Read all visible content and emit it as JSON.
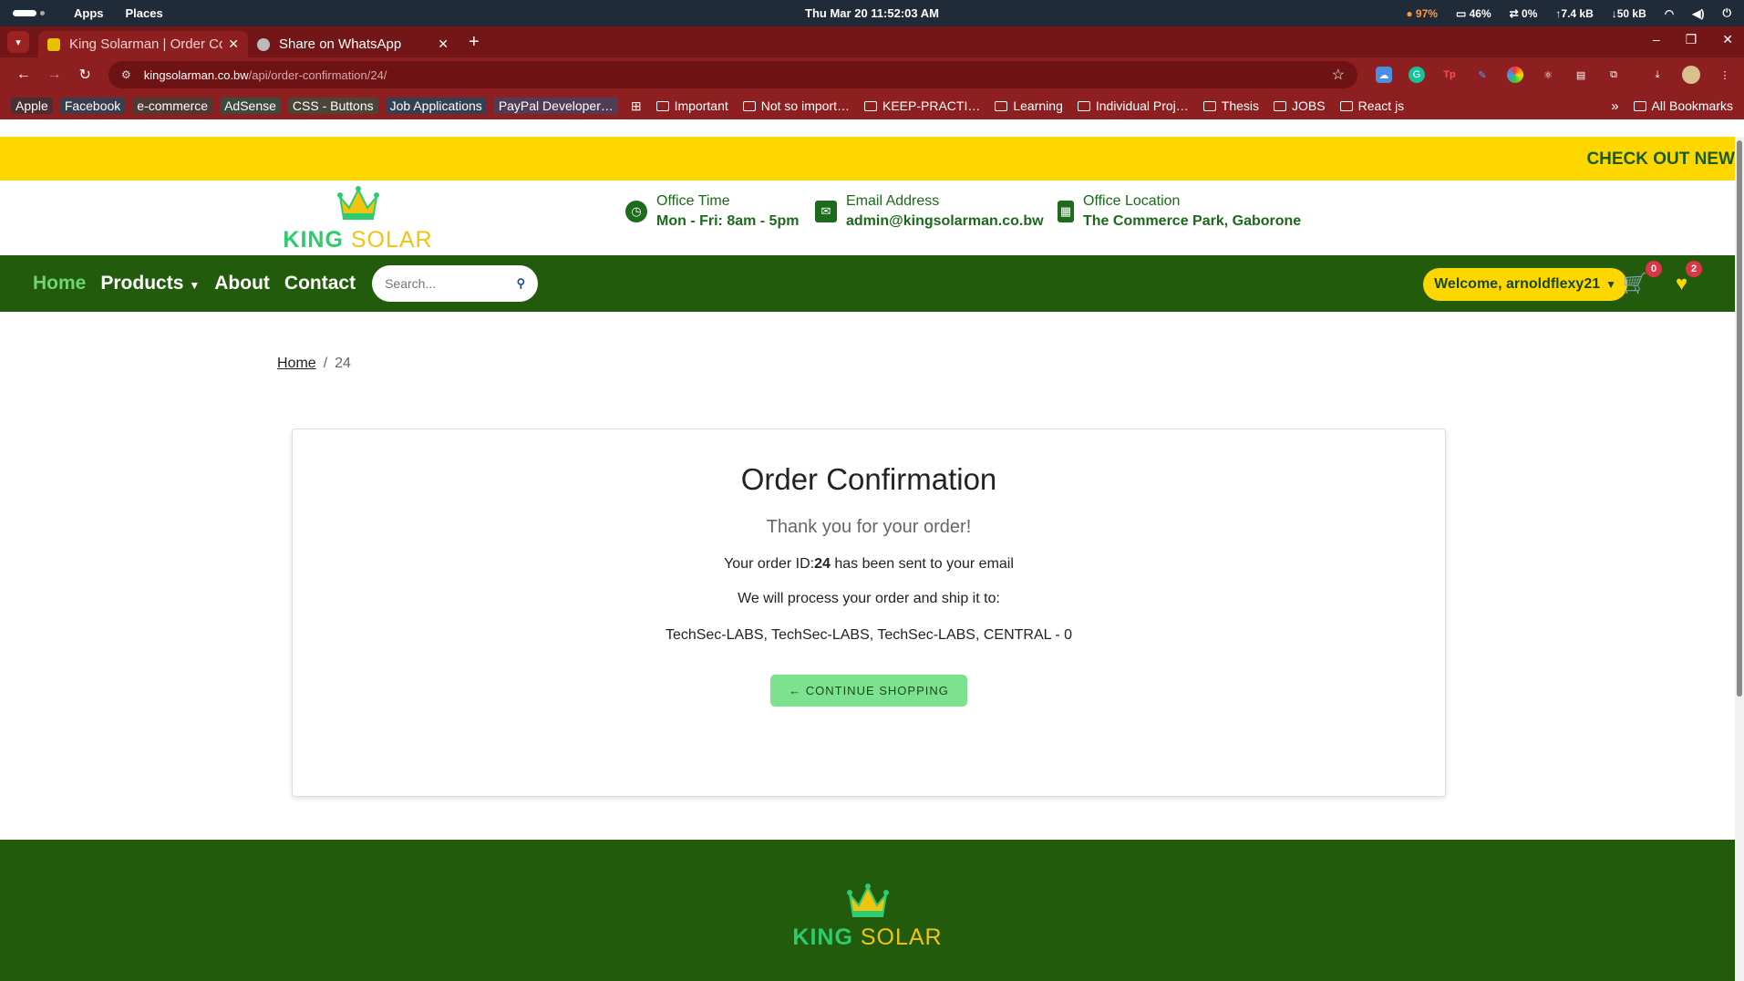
{
  "os": {
    "menu_apps": "Apps",
    "menu_places": "Places",
    "clock": "Thu Mar 20  11:52:03 AM",
    "battery": "97%",
    "cpu": "46%",
    "swap": "0%",
    "net_up": "↑7.4 kB",
    "net_down": "↓50 kB"
  },
  "browser": {
    "tabs": [
      {
        "title": "King Solarman | Order Confirmation"
      },
      {
        "title": "Share on WhatsApp"
      }
    ],
    "url_host": "kingsolarman.co.bw",
    "url_path": "/api/order-confirmation/24/",
    "bookmarks": [
      "Apple",
      "Facebook",
      "e-commerce",
      "AdSense",
      "CSS - Buttons",
      "Job Applications",
      "PayPal Developer…"
    ],
    "bookmark_folders": [
      "Important",
      "Not so import…",
      "KEEP-PRACTI…",
      "Learning",
      "Individual Proj…",
      "Thesis",
      "JOBS",
      "React js"
    ],
    "all_bookmarks": "All Bookmarks"
  },
  "site": {
    "promo_text": "CHECK OUT NEW",
    "logo_king": "KING",
    "logo_solar": "SOLAR",
    "office_time_label": "Office Time",
    "office_time_value": "Mon - Fri: 8am - 5pm",
    "email_label": "Email Address",
    "email_value": "admin@kingsolarman.co.bw",
    "location_label": "Office Location",
    "location_value": "The Commerce Park, Gaborone",
    "nav": {
      "home": "Home",
      "products": "Products",
      "about": "About",
      "contact": "Contact",
      "search_placeholder": "Search...",
      "welcome": "Welcome, arnoldflexy21",
      "cart_count": "0",
      "wishlist_count": "2"
    },
    "breadcrumb": {
      "home": "Home",
      "current": "24"
    }
  },
  "order": {
    "title": "Order Confirmation",
    "thanks": "Thank you for your order!",
    "id_prefix": "Your order ID:",
    "id": "24",
    "id_suffix": " has been sent to your email",
    "ship_text": "We will process your order and ship it to:",
    "address": "TechSec-LABS, TechSec-LABS, TechSec-LABS, CENTRAL - 0",
    "continue": "← CONTINUE SHOPPING"
  },
  "colors": {
    "brand_green": "#235b0d",
    "promo_yellow": "#ffd700",
    "browser_red": "#8e1f21"
  }
}
